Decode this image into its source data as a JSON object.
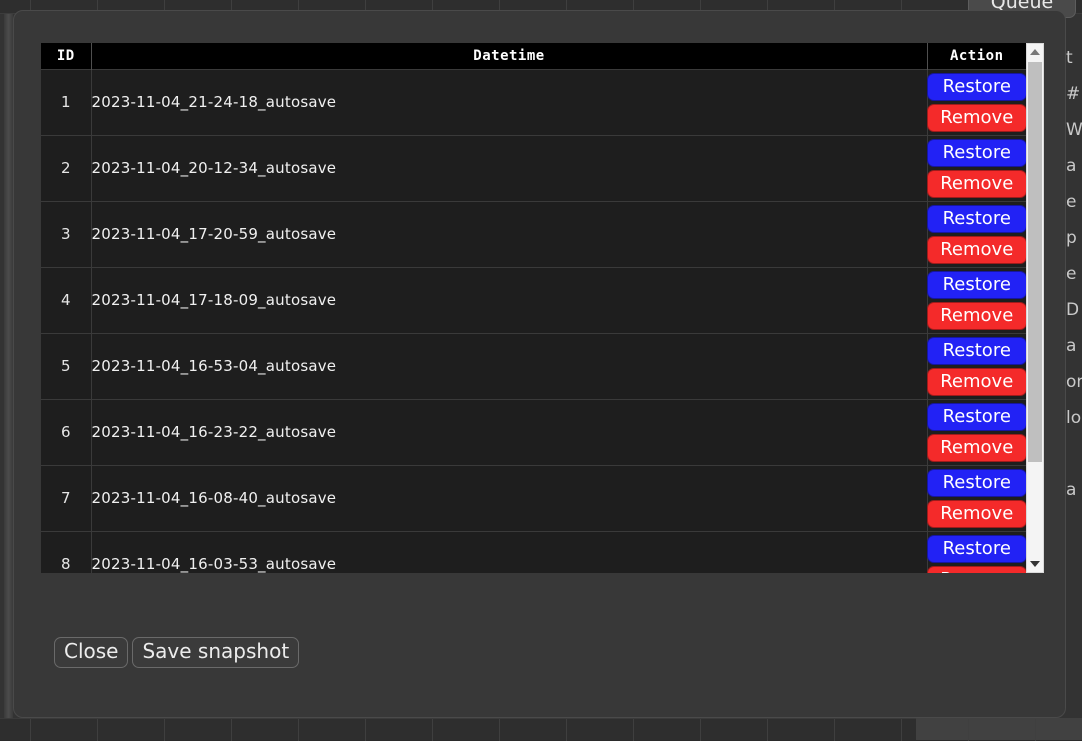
{
  "background": {
    "queue_pill_label": "Queue",
    "side_text_fragments": [
      "t",
      "#",
      "W",
      "a",
      "e",
      "p",
      "e",
      "D",
      "a",
      "on",
      "lo",
      "",
      "a"
    ]
  },
  "modal": {
    "table": {
      "columns": [
        "ID",
        "Datetime",
        "Action"
      ],
      "rows": [
        {
          "id": "1",
          "datetime": "2023-11-04_21-24-18_autosave",
          "restore_label": "Restore",
          "remove_label": "Remove"
        },
        {
          "id": "2",
          "datetime": "2023-11-04_20-12-34_autosave",
          "restore_label": "Restore",
          "remove_label": "Remove"
        },
        {
          "id": "3",
          "datetime": "2023-11-04_17-20-59_autosave",
          "restore_label": "Restore",
          "remove_label": "Remove"
        },
        {
          "id": "4",
          "datetime": "2023-11-04_17-18-09_autosave",
          "restore_label": "Restore",
          "remove_label": "Remove"
        },
        {
          "id": "5",
          "datetime": "2023-11-04_16-53-04_autosave",
          "restore_label": "Restore",
          "remove_label": "Remove"
        },
        {
          "id": "6",
          "datetime": "2023-11-04_16-23-22_autosave",
          "restore_label": "Restore",
          "remove_label": "Remove"
        },
        {
          "id": "7",
          "datetime": "2023-11-04_16-08-40_autosave",
          "restore_label": "Restore",
          "remove_label": "Remove"
        },
        {
          "id": "8",
          "datetime": "2023-11-04_16-03-53_autosave",
          "restore_label": "Restore",
          "remove_label": "Remove"
        }
      ]
    },
    "footer": {
      "close_label": "Close",
      "save_snapshot_label": "Save snapshot"
    }
  },
  "colors": {
    "restore_button": "#2222f5",
    "remove_button": "#f42a2a",
    "modal_background": "#383838",
    "table_header_background": "#000000",
    "table_row_background": "#1e1e1e"
  }
}
